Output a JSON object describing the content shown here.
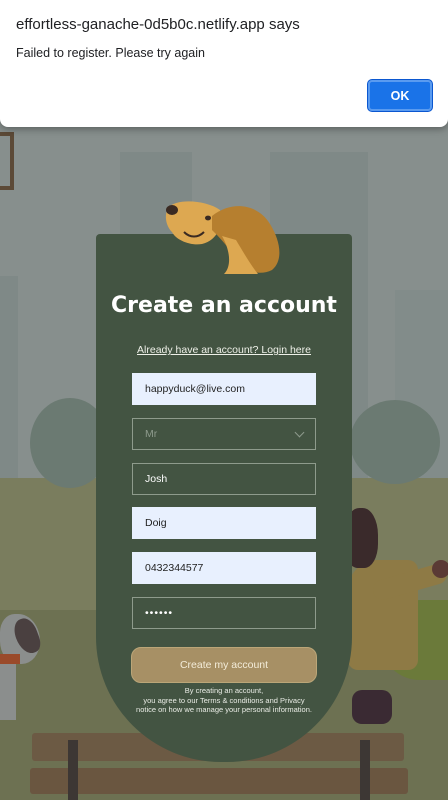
{
  "alert": {
    "title": "effortless-ganache-0d5b0c.netlify.app says",
    "message": "Failed to register. Please try again",
    "ok_label": "OK",
    "ok_color": "#1a73e8"
  },
  "form": {
    "title": "Create an account",
    "login_link": "Already have an account? Login here",
    "email_value": "happyduck@live.com",
    "title_select_value": "Mr",
    "first_name_value": "Josh",
    "last_name_value": "Doig",
    "phone_value": "0432344577",
    "password_value": "••••••",
    "submit_label": "Create my account",
    "terms_line1": "By creating an account,",
    "terms_line2": "you agree to our Terms & conditions and Privacy",
    "terms_line3": "notice on how we manage your personal information.",
    "card_color": "#435442",
    "button_color": "#a79065"
  }
}
